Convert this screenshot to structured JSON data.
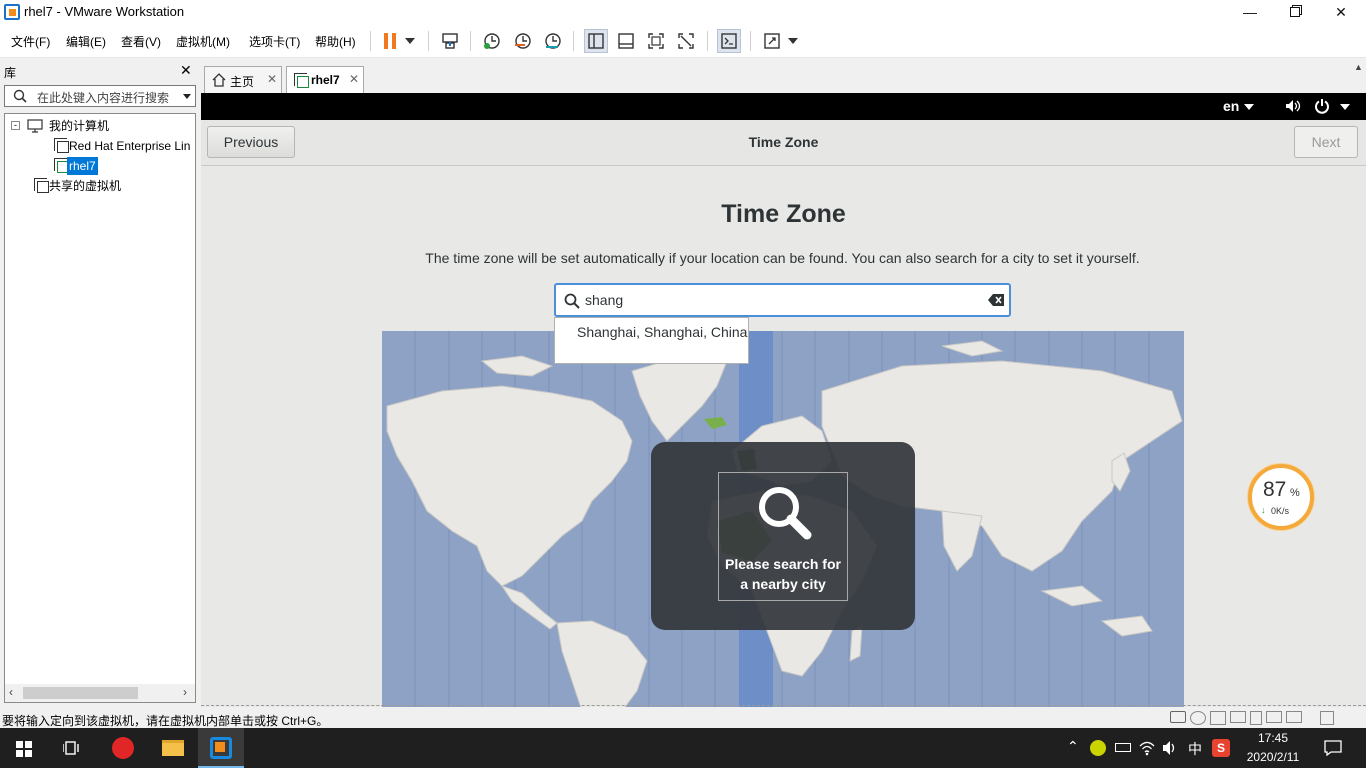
{
  "window": {
    "title": "rhel7 - VMware Workstation"
  },
  "menu": [
    "文件(F)",
    "编辑(E)",
    "查看(V)",
    "虚拟机(M)",
    "选项卡(T)",
    "帮助(H)"
  ],
  "library": {
    "title": "库",
    "search_placeholder": "在此处键入内容进行搜索",
    "tree": {
      "root": "我的计算机",
      "vm1": "Red Hat Enterprise Lin",
      "vm2": "rhel7",
      "shared": "共享的虚拟机"
    }
  },
  "tabs": [
    {
      "label": "主页"
    },
    {
      "label": "rhel7"
    }
  ],
  "gnome": {
    "lang": "en"
  },
  "installer": {
    "header_title": "Time Zone",
    "previous_label": "Previous",
    "next_label": "Next",
    "heading": "Time Zone",
    "description": "The time zone will be set automatically if your location can be found. You can also search for a city to set it yourself.",
    "search_value": "shang",
    "suggestion": "Shanghai, Shanghai, China",
    "overlay_text_1": "Please search for",
    "overlay_text_2": "a nearby city"
  },
  "status": {
    "hint": "要将输入定向到该虚拟机，请在虚拟机内部单击或按 Ctrl+G。"
  },
  "speed_widget": {
    "percent": "87",
    "percent_sign": "%",
    "speed": "0K/s"
  },
  "taskbar": {
    "ime": "中",
    "time": "17:45",
    "date": "2020/2/11"
  },
  "colors": {
    "accent": "#0078d7",
    "map_ocean": "#8ea2c6",
    "map_land": "#e9e8e4",
    "highlight_band": "#6e8ec8",
    "overlay": "#3c3f44"
  }
}
